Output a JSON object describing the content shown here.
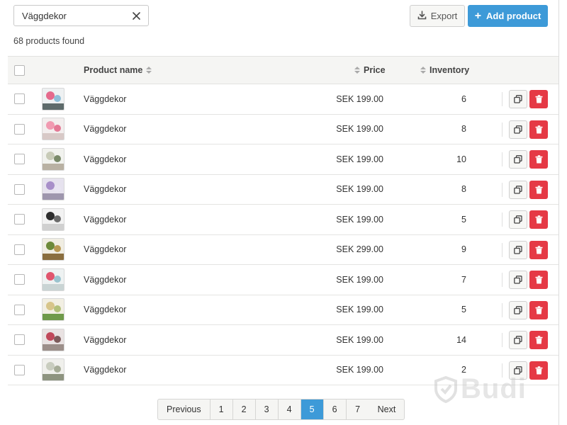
{
  "search": {
    "value": "Väggdekor",
    "placeholder": ""
  },
  "results_count": "68 products found",
  "toolbar": {
    "export_label": "Export",
    "add_label": "Add product"
  },
  "table": {
    "headers": {
      "name": "Product name",
      "price": "Price",
      "inventory": "Inventory"
    },
    "rows": [
      {
        "name": "Väggdekor",
        "price": "SEK 199.00",
        "inventory": "6",
        "thumb": {
          "bg": "#eef1f2",
          "a": "#e56a8c",
          "b": "#8fbfd8",
          "c": "#5e6b6b"
        }
      },
      {
        "name": "Väggdekor",
        "price": "SEK 199.00",
        "inventory": "8",
        "thumb": {
          "bg": "#f3eeee",
          "a": "#f19ab1",
          "b": "#e47995",
          "c": "#d8c9c7"
        }
      },
      {
        "name": "Väggdekor",
        "price": "SEK 199.00",
        "inventory": "10",
        "thumb": {
          "bg": "#f1f2ee",
          "a": "#c8cbb8",
          "b": "#7a8a6a",
          "c": "#b9b1a3"
        }
      },
      {
        "name": "Väggdekor",
        "price": "SEK 199.00",
        "inventory": "8",
        "thumb": {
          "bg": "#e6e2ee",
          "a": "#a88fc9",
          "b": "#e8e4f1",
          "c": "#9e96ad"
        }
      },
      {
        "name": "Väggdekor",
        "price": "SEK 199.00",
        "inventory": "5",
        "thumb": {
          "bg": "#f2f2f2",
          "a": "#2d2d2d",
          "b": "#6b6b6b",
          "c": "#d0d0d0"
        }
      },
      {
        "name": "Väggdekor",
        "price": "SEK 299.00",
        "inventory": "9",
        "thumb": {
          "bg": "#f0ede2",
          "a": "#6d8a3a",
          "b": "#b99a55",
          "c": "#8a6e3f"
        }
      },
      {
        "name": "Väggdekor",
        "price": "SEK 199.00",
        "inventory": "7",
        "thumb": {
          "bg": "#eef2f2",
          "a": "#e0566e",
          "b": "#9ac3ce",
          "c": "#c9d4d4"
        }
      },
      {
        "name": "Väggdekor",
        "price": "SEK 199.00",
        "inventory": "5",
        "thumb": {
          "bg": "#f2efe3",
          "a": "#d7c58a",
          "b": "#b2c07a",
          "c": "#6f9a4a"
        }
      },
      {
        "name": "Väggdekor",
        "price": "SEK 199.00",
        "inventory": "14",
        "thumb": {
          "bg": "#e9e2e2",
          "a": "#c0485a",
          "b": "#7d5b5b",
          "c": "#9c8f8a"
        }
      },
      {
        "name": "Väggdekor",
        "price": "SEK 199.00",
        "inventory": "2",
        "thumb": {
          "bg": "#f0f0ec",
          "a": "#c9cdbf",
          "b": "#a7ad98",
          "c": "#8e9480"
        }
      }
    ]
  },
  "pagination": {
    "previous": "Previous",
    "next": "Next",
    "pages": [
      "1",
      "2",
      "3",
      "4",
      "5",
      "6",
      "7"
    ],
    "current": "5"
  },
  "watermark": "Budi",
  "colors": {
    "accent": "#3d9ad8",
    "danger": "#e53945"
  }
}
